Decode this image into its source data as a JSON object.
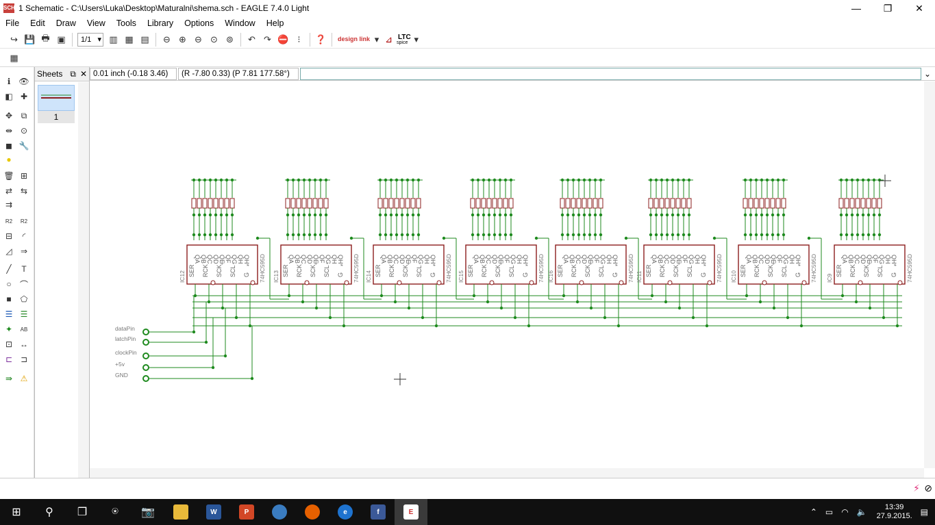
{
  "window": {
    "app_icon": "SCH",
    "title": "1 Schematic - C:\\Users\\Luka\\Desktop\\Maturalni\\shema.sch - EAGLE 7.4.0 Light",
    "controls": {
      "minimize": "—",
      "maximize": "❐",
      "close": "✕"
    }
  },
  "menu": [
    "File",
    "Edit",
    "Draw",
    "View",
    "Tools",
    "Library",
    "Options",
    "Window",
    "Help"
  ],
  "toolbar": {
    "sheet_select": "1/1",
    "designlink": "design link",
    "ltc": "LTC",
    "ltc_sub": "spice"
  },
  "sheets_panel": {
    "title": "Sheets",
    "sheet_number": "1"
  },
  "status": {
    "grid": "0.01 inch (-0.18 3.46)",
    "polar": "(R -7.80 0.33) (P 7.81 177.58°)",
    "command": ""
  },
  "schematic": {
    "ic_count": 8,
    "ics": [
      {
        "ref": "IC12",
        "part": "74HC595D"
      },
      {
        "ref": "IC13",
        "part": "74HC595D"
      },
      {
        "ref": "IC14",
        "part": "74HC595D"
      },
      {
        "ref": "IC15",
        "part": "74HC595D"
      },
      {
        "ref": "IC16",
        "part": "74HC595D"
      },
      {
        "ref": "IC11",
        "part": "74HC595D"
      },
      {
        "ref": "IC10",
        "part": "74HC595D"
      },
      {
        "ref": "IC9",
        "part": "74HC595D"
      }
    ],
    "top_pins": [
      "QA",
      "QB",
      "QC",
      "QD",
      "QE",
      "QF",
      "QG",
      "QH",
      "QH*"
    ],
    "bottom_pins": [
      "SER",
      "RCK",
      "SCK",
      "SCL",
      "G"
    ],
    "pins": [
      "dataPin",
      "latchPin",
      "clockPin",
      "+5v",
      "GND"
    ],
    "colors": {
      "wire": "#1e8a1e",
      "part": "#8b1c1c",
      "junction": "#1e8a1e"
    }
  },
  "taskbar": {
    "time": "13:39",
    "date": "27.9.2015."
  }
}
